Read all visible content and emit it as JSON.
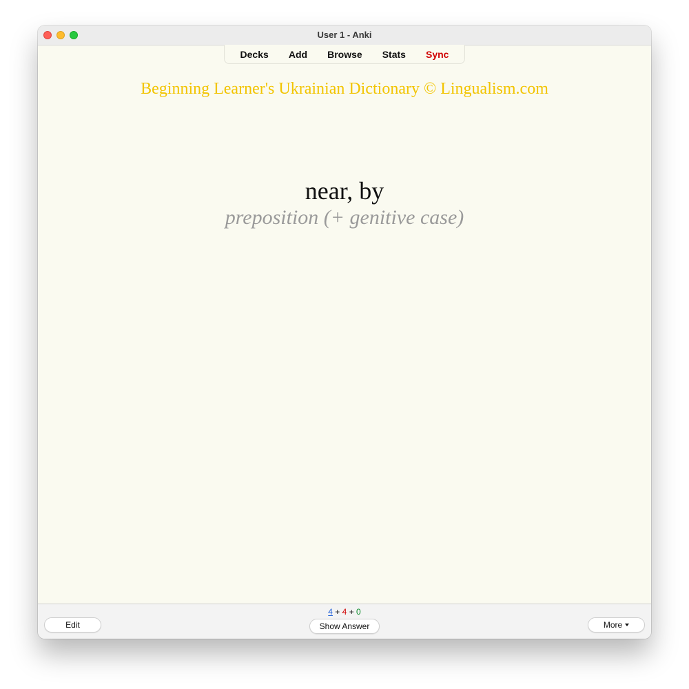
{
  "window": {
    "title": "User 1 - Anki"
  },
  "toolbar": {
    "decks": "Decks",
    "add": "Add",
    "browse": "Browse",
    "stats": "Stats",
    "sync": "Sync"
  },
  "card": {
    "header": "Beginning Learner's Ukrainian Dictionary © Lingualism.com",
    "term": "near, by",
    "part_of_speech": "preposition (+ genitive case)"
  },
  "bottom": {
    "edit_label": "Edit",
    "show_answer_label": "Show Answer",
    "more_label": "More",
    "counts": {
      "new": "4",
      "sep1": "+",
      "learning": "4",
      "sep2": "+",
      "review": "0"
    }
  },
  "colors": {
    "card_background": "#fafaf0",
    "header_text": "#f2c400",
    "sync_text": "#d00000",
    "pos_text": "#9a9a9a",
    "new_count": "#1e5fd8",
    "learning_count": "#d00000",
    "review_count": "#0a8a2a"
  }
}
